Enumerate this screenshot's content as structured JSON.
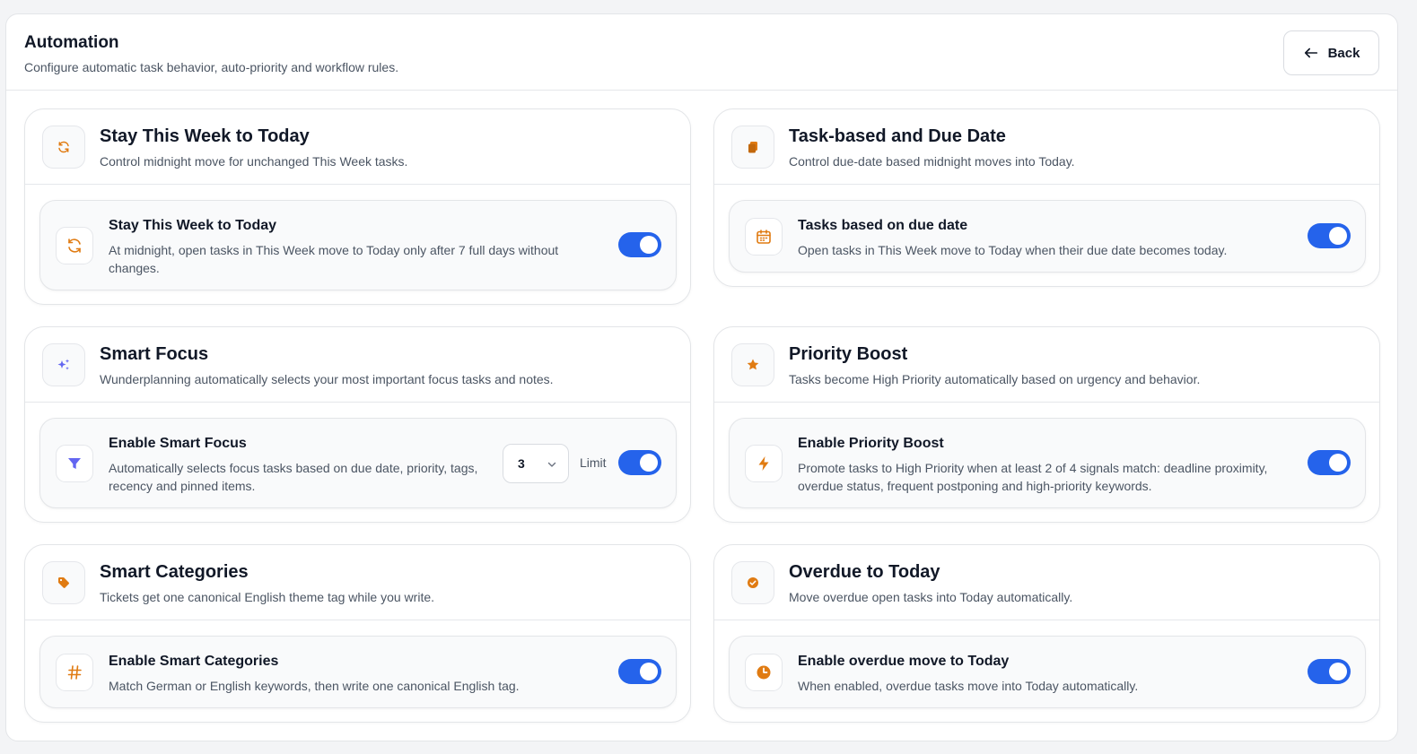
{
  "header": {
    "title": "Automation",
    "subtitle": "Configure automatic task behavior, auto-priority and workflow rules.",
    "back_label": "Back"
  },
  "colors": {
    "accent": "#2563eb",
    "orange": "#e07b12",
    "purple": "#6366f1"
  },
  "cards": {
    "stay_week": {
      "title": "Stay This Week to Today",
      "description": "Control midnight move for unchanged This Week tasks.",
      "icon": "refresh-icon",
      "setting": {
        "title": "Stay This Week to Today",
        "description": "At midnight, open tasks in This Week move to Today only after 7 full days without changes.",
        "icon": "refresh-icon",
        "enabled": true
      }
    },
    "due_date": {
      "title": "Task-based and Due Date",
      "description": "Control due-date based midnight moves into Today.",
      "icon": "copy-icon",
      "setting": {
        "title": "Tasks based on due date",
        "description": "Open tasks in This Week move to Today when their due date becomes today.",
        "icon": "calendar-icon",
        "enabled": true
      }
    },
    "smart_focus": {
      "title": "Smart Focus",
      "description": "Wunderplanning automatically selects your most important focus tasks and notes.",
      "icon": "sparkles-icon",
      "setting": {
        "title": "Enable Smart Focus",
        "description": "Automatically selects focus tasks based on due date, priority, tags, recency and pinned items.",
        "icon": "filter-icon",
        "limit_value": "3",
        "limit_label": "Limit",
        "enabled": true
      }
    },
    "priority_boost": {
      "title": "Priority Boost",
      "description": "Tasks become High Priority automatically based on urgency and behavior.",
      "icon": "star-icon",
      "setting": {
        "title": "Enable Priority Boost",
        "description": "Promote tasks to High Priority when at least 2 of 4 signals match: deadline proximity, overdue status, frequent postponing and high-priority keywords.",
        "icon": "lightning-icon",
        "enabled": true
      }
    },
    "smart_categories": {
      "title": "Smart Categories",
      "description": "Tickets get one canonical English theme tag while you write.",
      "icon": "tag-icon",
      "setting": {
        "title": "Enable Smart Categories",
        "description": "Match German or English keywords, then write one canonical English tag.",
        "icon": "hash-icon",
        "enabled": true
      }
    },
    "overdue": {
      "title": "Overdue to Today",
      "description": "Move overdue open tasks into Today automatically.",
      "icon": "check-circle-icon",
      "setting": {
        "title": "Enable overdue move to Today",
        "description": "When enabled, overdue tasks move into Today automatically.",
        "icon": "clock-icon",
        "enabled": true
      }
    }
  }
}
